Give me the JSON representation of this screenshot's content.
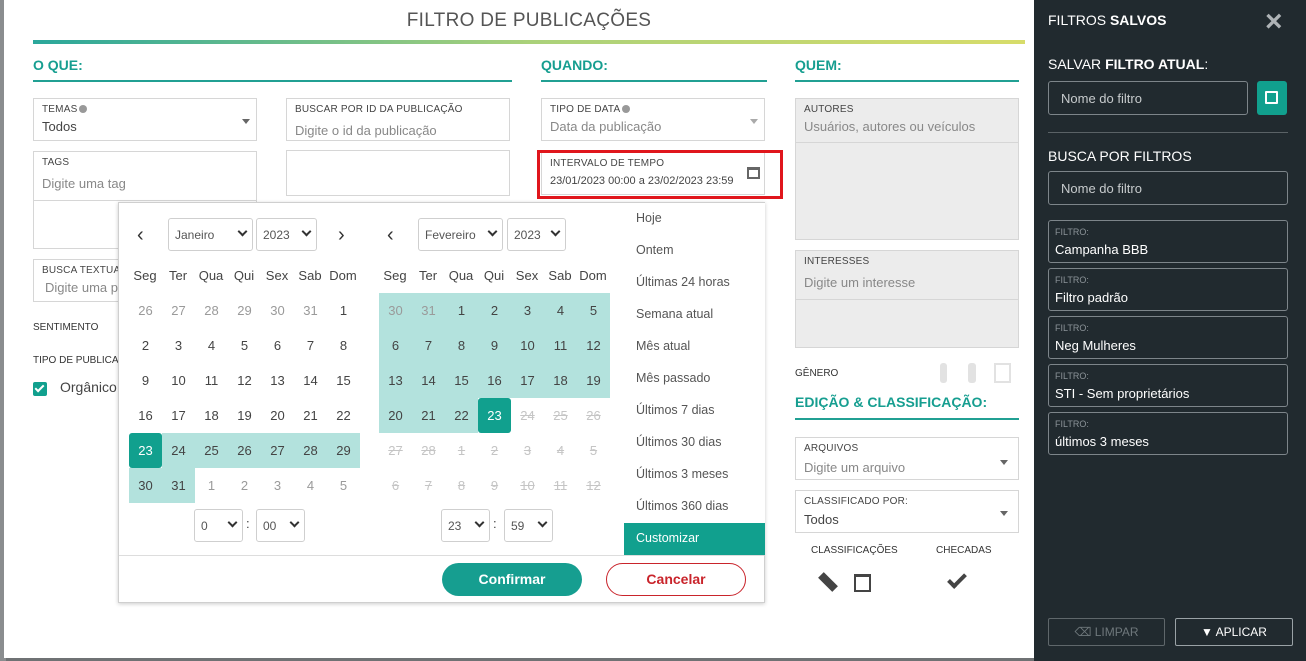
{
  "modal": {
    "title": "FILTRO DE PUBLICAÇÕES"
  },
  "o_que": {
    "heading": "O QUE:",
    "temas_label": "TEMAS",
    "temas_value": "Todos",
    "buscar_id_label": "BUSCAR POR ID DA PUBLICAÇÃO",
    "buscar_id_placeholder": "Digite o id da publicação",
    "tags_label": "TAGS",
    "tags_placeholder": "Digite uma tag",
    "busca_textual_label": "BUSCA TEXTUAL",
    "busca_textual_placeholder": "Digite uma p",
    "sentimento_label": "SENTIMENTO",
    "tipo_pub_label": "TIPO DE PUBLICAÇ",
    "organico_label": "Orgânico"
  },
  "quando": {
    "heading": "QUANDO:",
    "tipo_data_label": "TIPO DE DATA",
    "tipo_data_value": "Data da publicação",
    "intervalo_label": "INTERVALO DE TEMPO",
    "intervalo_value": "23/01/2023 00:00 a 23/02/2023 23:59"
  },
  "quem": {
    "heading": "QUEM:",
    "autores_label": "AUTORES",
    "autores_placeholder": "Usuários, autores ou veículos",
    "interesses_label": "INTERESSES",
    "interesses_placeholder": "Digite um interesse",
    "genero_label": "GÊNERO"
  },
  "edicao": {
    "heading": "EDIÇÃO & CLASSIFICAÇÃO:",
    "arquivos_label": "ARQUIVOS",
    "arquivos_placeholder": "Digite um arquivo",
    "classificado_label": "CLASSIFICADO POR:",
    "classificado_value": "Todos",
    "classificacoes_label": "CLASSIFICAÇÕES",
    "checadas_label": "CHECADAS"
  },
  "calendar": {
    "weekdays": [
      "Seg",
      "Ter",
      "Qua",
      "Qui",
      "Sex",
      "Sab",
      "Dom"
    ],
    "left": {
      "month": "Janeiro",
      "year": "2023",
      "hour": "0",
      "minute": "00",
      "days": [
        [
          "26",
          "27",
          "28",
          "29",
          "30",
          "31",
          "1"
        ],
        [
          "2",
          "3",
          "4",
          "5",
          "6",
          "7",
          "8"
        ],
        [
          "9",
          "10",
          "11",
          "12",
          "13",
          "14",
          "15"
        ],
        [
          "16",
          "17",
          "18",
          "19",
          "20",
          "21",
          "22"
        ],
        [
          "23",
          "24",
          "25",
          "26",
          "27",
          "28",
          "29"
        ],
        [
          "30",
          "31",
          "1",
          "2",
          "3",
          "4",
          "5"
        ]
      ]
    },
    "right": {
      "month": "Fevereiro",
      "year": "2023",
      "hour": "23",
      "minute": "59",
      "days": [
        [
          "30",
          "31",
          "1",
          "2",
          "3",
          "4",
          "5"
        ],
        [
          "6",
          "7",
          "8",
          "9",
          "10",
          "11",
          "12"
        ],
        [
          "13",
          "14",
          "15",
          "16",
          "17",
          "18",
          "19"
        ],
        [
          "20",
          "21",
          "22",
          "23",
          "24",
          "25",
          "26"
        ],
        [
          "27",
          "28",
          "1",
          "2",
          "3",
          "4",
          "5"
        ],
        [
          "6",
          "7",
          "8",
          "9",
          "10",
          "11",
          "12"
        ]
      ]
    },
    "ranges": [
      "Hoje",
      "Ontem",
      "Últimas 24 horas",
      "Semana atual",
      "Mês atual",
      "Mês passado",
      "Últimos 7 dias",
      "Últimos 30 dias",
      "Últimos 3 meses",
      "Últimos 360 dias",
      "Customizar"
    ],
    "active_range": "Customizar",
    "confirm_label": "Confirmar",
    "cancel_label": "Cancelar",
    "colors": {
      "selected": "#11a08e",
      "in_range": "#b3e2dd"
    }
  },
  "sidebar": {
    "title_plain": "FILTROS ",
    "title_bold": "SALVOS",
    "salvar_plain": "SALVAR ",
    "salvar_bold": "FILTRO ATUAL",
    "salvar_suffix": ":",
    "name_placeholder": "Nome do filtro",
    "busca_label": "BUSCA POR FILTROS",
    "busca_placeholder": "Nome do filtro",
    "filter_tag": "FILTRO:",
    "saved": [
      "Campanha BBB",
      "Filtro padrão",
      "Neg Mulheres",
      "STI - Sem proprietários",
      "últimos 3 meses"
    ],
    "limpar_label": "LIMPAR",
    "aplicar_label": "APLICAR"
  }
}
